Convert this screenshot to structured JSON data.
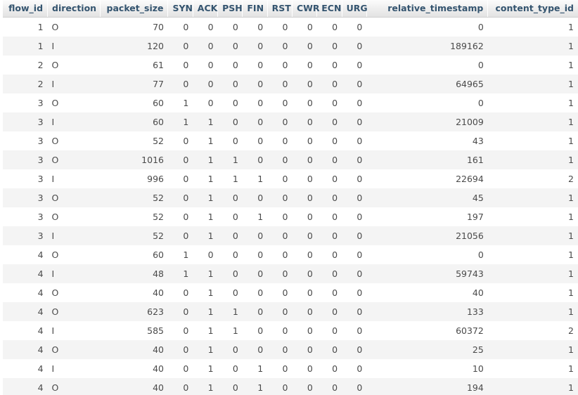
{
  "table": {
    "columns": [
      {
        "key": "flow_id",
        "label": "flow_id",
        "align": "right",
        "headerAlign": "right"
      },
      {
        "key": "direction",
        "label": "direction",
        "align": "left",
        "headerAlign": "left"
      },
      {
        "key": "packet_size",
        "label": "packet_size",
        "align": "right",
        "headerAlign": "right"
      },
      {
        "key": "SYN",
        "label": "SYN",
        "align": "right",
        "headerAlign": "center"
      },
      {
        "key": "ACK",
        "label": "ACK",
        "align": "right",
        "headerAlign": "center"
      },
      {
        "key": "PSH",
        "label": "PSH",
        "align": "right",
        "headerAlign": "center"
      },
      {
        "key": "FIN",
        "label": "FIN",
        "align": "right",
        "headerAlign": "center"
      },
      {
        "key": "RST",
        "label": "RST",
        "align": "right",
        "headerAlign": "center"
      },
      {
        "key": "CWR",
        "label": "CWR",
        "align": "right",
        "headerAlign": "center"
      },
      {
        "key": "ECN",
        "label": "ECN",
        "align": "right",
        "headerAlign": "center"
      },
      {
        "key": "URG",
        "label": "URG",
        "align": "right",
        "headerAlign": "center"
      },
      {
        "key": "relative_timestamp",
        "label": "relative_timestamp",
        "align": "right",
        "headerAlign": "right"
      },
      {
        "key": "content_type_id",
        "label": "content_type_id",
        "align": "right",
        "headerAlign": "right"
      }
    ],
    "rows": [
      {
        "flow_id": "1",
        "direction": "O",
        "packet_size": "70",
        "SYN": "0",
        "ACK": "0",
        "PSH": "0",
        "FIN": "0",
        "RST": "0",
        "CWR": "0",
        "ECN": "0",
        "URG": "0",
        "relative_timestamp": "0",
        "content_type_id": "1"
      },
      {
        "flow_id": "1",
        "direction": "I",
        "packet_size": "120",
        "SYN": "0",
        "ACK": "0",
        "PSH": "0",
        "FIN": "0",
        "RST": "0",
        "CWR": "0",
        "ECN": "0",
        "URG": "0",
        "relative_timestamp": "189162",
        "content_type_id": "1"
      },
      {
        "flow_id": "2",
        "direction": "O",
        "packet_size": "61",
        "SYN": "0",
        "ACK": "0",
        "PSH": "0",
        "FIN": "0",
        "RST": "0",
        "CWR": "0",
        "ECN": "0",
        "URG": "0",
        "relative_timestamp": "0",
        "content_type_id": "1"
      },
      {
        "flow_id": "2",
        "direction": "I",
        "packet_size": "77",
        "SYN": "0",
        "ACK": "0",
        "PSH": "0",
        "FIN": "0",
        "RST": "0",
        "CWR": "0",
        "ECN": "0",
        "URG": "0",
        "relative_timestamp": "64965",
        "content_type_id": "1"
      },
      {
        "flow_id": "3",
        "direction": "O",
        "packet_size": "60",
        "SYN": "1",
        "ACK": "0",
        "PSH": "0",
        "FIN": "0",
        "RST": "0",
        "CWR": "0",
        "ECN": "0",
        "URG": "0",
        "relative_timestamp": "0",
        "content_type_id": "1"
      },
      {
        "flow_id": "3",
        "direction": "I",
        "packet_size": "60",
        "SYN": "1",
        "ACK": "1",
        "PSH": "0",
        "FIN": "0",
        "RST": "0",
        "CWR": "0",
        "ECN": "0",
        "URG": "0",
        "relative_timestamp": "21009",
        "content_type_id": "1"
      },
      {
        "flow_id": "3",
        "direction": "O",
        "packet_size": "52",
        "SYN": "0",
        "ACK": "1",
        "PSH": "0",
        "FIN": "0",
        "RST": "0",
        "CWR": "0",
        "ECN": "0",
        "URG": "0",
        "relative_timestamp": "43",
        "content_type_id": "1"
      },
      {
        "flow_id": "3",
        "direction": "O",
        "packet_size": "1016",
        "SYN": "0",
        "ACK": "1",
        "PSH": "1",
        "FIN": "0",
        "RST": "0",
        "CWR": "0",
        "ECN": "0",
        "URG": "0",
        "relative_timestamp": "161",
        "content_type_id": "1"
      },
      {
        "flow_id": "3",
        "direction": "I",
        "packet_size": "996",
        "SYN": "0",
        "ACK": "1",
        "PSH": "1",
        "FIN": "1",
        "RST": "0",
        "CWR": "0",
        "ECN": "0",
        "URG": "0",
        "relative_timestamp": "22694",
        "content_type_id": "2"
      },
      {
        "flow_id": "3",
        "direction": "O",
        "packet_size": "52",
        "SYN": "0",
        "ACK": "1",
        "PSH": "0",
        "FIN": "0",
        "RST": "0",
        "CWR": "0",
        "ECN": "0",
        "URG": "0",
        "relative_timestamp": "45",
        "content_type_id": "1"
      },
      {
        "flow_id": "3",
        "direction": "O",
        "packet_size": "52",
        "SYN": "0",
        "ACK": "1",
        "PSH": "0",
        "FIN": "1",
        "RST": "0",
        "CWR": "0",
        "ECN": "0",
        "URG": "0",
        "relative_timestamp": "197",
        "content_type_id": "1"
      },
      {
        "flow_id": "3",
        "direction": "I",
        "packet_size": "52",
        "SYN": "0",
        "ACK": "1",
        "PSH": "0",
        "FIN": "0",
        "RST": "0",
        "CWR": "0",
        "ECN": "0",
        "URG": "0",
        "relative_timestamp": "21056",
        "content_type_id": "1"
      },
      {
        "flow_id": "4",
        "direction": "O",
        "packet_size": "60",
        "SYN": "1",
        "ACK": "0",
        "PSH": "0",
        "FIN": "0",
        "RST": "0",
        "CWR": "0",
        "ECN": "0",
        "URG": "0",
        "relative_timestamp": "0",
        "content_type_id": "1"
      },
      {
        "flow_id": "4",
        "direction": "I",
        "packet_size": "48",
        "SYN": "1",
        "ACK": "1",
        "PSH": "0",
        "FIN": "0",
        "RST": "0",
        "CWR": "0",
        "ECN": "0",
        "URG": "0",
        "relative_timestamp": "59743",
        "content_type_id": "1"
      },
      {
        "flow_id": "4",
        "direction": "O",
        "packet_size": "40",
        "SYN": "0",
        "ACK": "1",
        "PSH": "0",
        "FIN": "0",
        "RST": "0",
        "CWR": "0",
        "ECN": "0",
        "URG": "0",
        "relative_timestamp": "40",
        "content_type_id": "1"
      },
      {
        "flow_id": "4",
        "direction": "O",
        "packet_size": "623",
        "SYN": "0",
        "ACK": "1",
        "PSH": "1",
        "FIN": "0",
        "RST": "0",
        "CWR": "0",
        "ECN": "0",
        "URG": "0",
        "relative_timestamp": "133",
        "content_type_id": "1"
      },
      {
        "flow_id": "4",
        "direction": "I",
        "packet_size": "585",
        "SYN": "0",
        "ACK": "1",
        "PSH": "1",
        "FIN": "0",
        "RST": "0",
        "CWR": "0",
        "ECN": "0",
        "URG": "0",
        "relative_timestamp": "60372",
        "content_type_id": "2"
      },
      {
        "flow_id": "4",
        "direction": "O",
        "packet_size": "40",
        "SYN": "0",
        "ACK": "1",
        "PSH": "0",
        "FIN": "0",
        "RST": "0",
        "CWR": "0",
        "ECN": "0",
        "URG": "0",
        "relative_timestamp": "25",
        "content_type_id": "1"
      },
      {
        "flow_id": "4",
        "direction": "I",
        "packet_size": "40",
        "SYN": "0",
        "ACK": "1",
        "PSH": "0",
        "FIN": "1",
        "RST": "0",
        "CWR": "0",
        "ECN": "0",
        "URG": "0",
        "relative_timestamp": "10",
        "content_type_id": "1"
      },
      {
        "flow_id": "4",
        "direction": "O",
        "packet_size": "40",
        "SYN": "0",
        "ACK": "1",
        "PSH": "0",
        "FIN": "1",
        "RST": "0",
        "CWR": "0",
        "ECN": "0",
        "URG": "0",
        "relative_timestamp": "194",
        "content_type_id": "1"
      }
    ]
  },
  "colors": {
    "header_text": "#34546f",
    "header_bg_top": "#fcfcfc",
    "header_bg_bottom": "#e3e3e3",
    "row_odd_bg": "#ffffff",
    "row_even_bg": "#f4f4f4",
    "cell_text": "#4a4a4a"
  }
}
